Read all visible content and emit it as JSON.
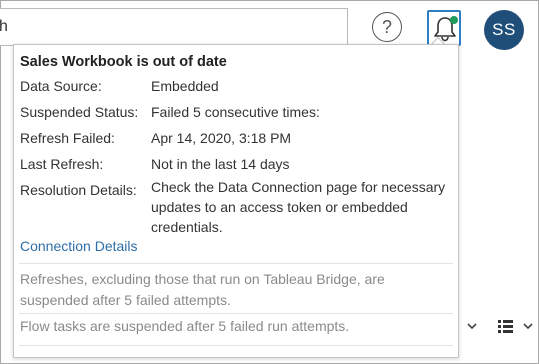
{
  "header": {
    "search_value": "h",
    "help_icon_glyph": "?",
    "help_icon": "help-icon",
    "notifications_icon": "bell-icon",
    "notification_dot_color": "#1e9a5a",
    "avatar_initials": "SS",
    "avatar_color": "#1f4e79"
  },
  "notification": {
    "title": "Sales Workbook is out of date",
    "rows": [
      {
        "label": "Data Source:",
        "value": "Embedded"
      },
      {
        "label": "Suspended Status:",
        "value": "Failed 5 consecutive times:"
      },
      {
        "label": "Refresh Failed:",
        "value": "Apr 14, 2020, 3:18 PM"
      },
      {
        "label": "Last Refresh:",
        "value": "Not in the last 14 days"
      },
      {
        "label": "Resolution Details:",
        "value": "Check the Data Connection page for necessary updates to an access token or embedded credentials."
      }
    ],
    "link_label": "Connection Details",
    "link_color": "#2e6ea6",
    "note_refreshes": "Refreshes, excluding those that run on Tableau Bridge, are suspended after 5 failed attempts.",
    "note_flows": "Flow tasks are suspended after 5 failed run attempts."
  },
  "background_controls": {
    "dropdown_icon": "chevron-down-icon",
    "view_icon": "list-view-icon"
  }
}
